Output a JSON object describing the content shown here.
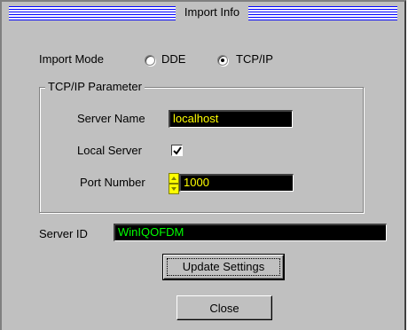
{
  "window": {
    "title": "Import Info"
  },
  "import_mode": {
    "label": "Import Mode",
    "options": [
      {
        "label": "DDE",
        "selected": false
      },
      {
        "label": "TCP/IP",
        "selected": true
      }
    ]
  },
  "tcpip": {
    "group_label": "TCP/IP Parameter",
    "server_name_label": "Server Name",
    "server_name_value": "localhost",
    "local_server_label": "Local Server",
    "local_server_checked": true,
    "port_number_label": "Port Number",
    "port_number_value": "1000"
  },
  "server_id": {
    "label": "Server ID",
    "value": "WinIQOFDM"
  },
  "buttons": {
    "update_settings_label": "Update Settings",
    "close_label": "Close"
  },
  "colors": {
    "dialog_bg": "#c0c0c0",
    "field_bg": "#000000",
    "field_text_yellow": "#ffff00",
    "field_text_green": "#00ff00",
    "title_stripe": "#0000ff"
  }
}
